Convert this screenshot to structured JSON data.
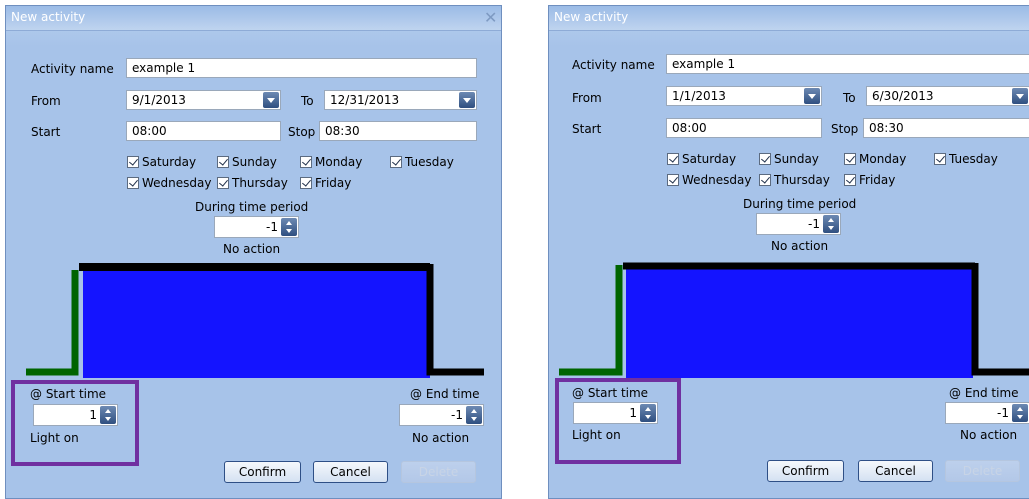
{
  "dialogs": [
    {
      "title": "New activity",
      "close_glyph": "✕",
      "activity_name_label": "Activity name",
      "activity_name_value": "example 1",
      "from_label": "From",
      "from_value": "9/1/2013",
      "to_label": "To",
      "to_value": "12/31/2013",
      "start_label": "Start",
      "start_value": "08:00",
      "stop_label": "Stop",
      "stop_value": "08:30",
      "days": [
        "Saturday",
        "Sunday",
        "Monday",
        "Tuesday",
        "Wednesday",
        "Thursday",
        "Friday"
      ],
      "during_label": "During time period",
      "during_value": "-1",
      "during_action": "No action",
      "start_time_label": "@ Start time",
      "start_time_value": "1",
      "start_action": "Light on",
      "end_time_label": "@ End time",
      "end_time_value": "-1",
      "end_action": "No action",
      "confirm_label": "Confirm",
      "cancel_label": "Cancel",
      "delete_label": "Delete"
    },
    {
      "title": "New activity",
      "activity_name_label": "Activity name",
      "activity_name_value": "example 1",
      "from_label": "From",
      "from_value": "1/1/2013",
      "to_label": "To",
      "to_value": "6/30/2013",
      "start_label": "Start",
      "start_value": "08:00",
      "stop_label": "Stop",
      "stop_value": "08:30",
      "days": [
        "Saturday",
        "Sunday",
        "Monday",
        "Tuesday",
        "Wednesday",
        "Thursday",
        "Friday"
      ],
      "during_label": "During time period",
      "during_value": "-1",
      "during_action": "No action",
      "start_time_label": "@ Start time",
      "start_time_value": "1",
      "start_action": "Light on",
      "end_time_label": "@ End time",
      "end_time_value": "-1",
      "end_action": "No action",
      "confirm_label": "Confirm",
      "cancel_label": "Cancel",
      "delete_label": "Delete"
    }
  ],
  "colors": {
    "fill": "#1414ff",
    "start_segment": "#006400",
    "end_segment": "#000000",
    "highlight": "#7030a0"
  }
}
